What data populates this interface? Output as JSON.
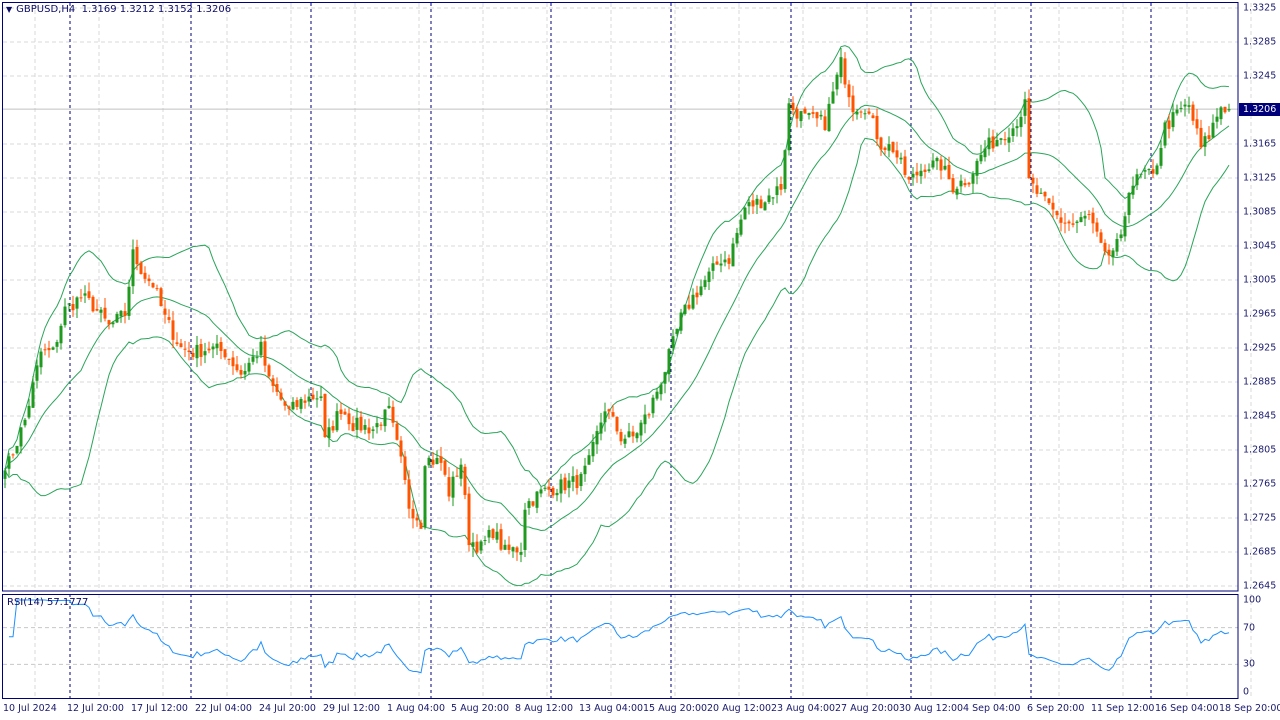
{
  "header": {
    "symbol": "GBPUSD,H4",
    "ohlc": "1.3169 1.3212 1.3152 1.3206",
    "current_price": "1.3206"
  },
  "rsi_label": "RSI(14) 57.1777",
  "price_axis": [
    "1.3325",
    "1.3285",
    "1.3245",
    "1.3165",
    "1.3125",
    "1.3085",
    "1.3045",
    "1.3005",
    "1.2965",
    "1.2925",
    "1.2885",
    "1.2845",
    "1.2805",
    "1.2765",
    "1.2725",
    "1.2685",
    "1.2645"
  ],
  "rsi_axis": [
    "100",
    "70",
    "30",
    "0"
  ],
  "time_axis": [
    "10 Jul 2024",
    "12 Jul 20:00",
    "17 Jul 12:00",
    "22 Jul 04:00",
    "24 Jul 20:00",
    "29 Jul 12:00",
    "1 Aug 04:00",
    "5 Aug 20:00",
    "8 Aug 12:00",
    "13 Aug 04:00",
    "15 Aug 20:00",
    "20 Aug 12:00",
    "23 Aug 04:00",
    "27 Aug 20:00",
    "30 Aug 12:00",
    "4 Sep 04:00",
    "6 Sep 20:00",
    "11 Sep 12:00",
    "16 Sep 04:00",
    "18 Sep 20:00"
  ],
  "colors": {
    "bull": "#1f9a1f",
    "bear": "#ff5500",
    "bands": "#2aa55a",
    "rsi": "#1e90ff",
    "axis": "#00007a",
    "grid": "#d8d8d8",
    "separator": "#00007a"
  },
  "chart_data": {
    "type": "candlestick",
    "symbol": "GBPUSD",
    "timeframe": "H4",
    "ylim": [
      1.2645,
      1.3325
    ],
    "bars_per_label": 16,
    "indicators": [
      "Bollinger Bands(20,2)",
      "RSI(14)"
    ],
    "close_keypoints": [
      [
        1,
        1.279
      ],
      [
        5,
        1.284
      ],
      [
        9,
        1.292
      ],
      [
        12,
        1.292
      ],
      [
        15,
        1.297
      ],
      [
        19,
        1.2985
      ],
      [
        22,
        1.2975
      ],
      [
        26,
        1.295
      ],
      [
        30,
        1.2965
      ],
      [
        32,
        1.3035
      ],
      [
        35,
        1.301
      ],
      [
        37,
        1.3
      ],
      [
        40,
        1.296
      ],
      [
        44,
        1.2925
      ],
      [
        47,
        1.292
      ],
      [
        51,
        1.2925
      ],
      [
        55,
        1.292
      ],
      [
        59,
        1.2895
      ],
      [
        64,
        1.2925
      ],
      [
        66,
        1.2885
      ],
      [
        71,
        1.285
      ],
      [
        75,
        1.2865
      ],
      [
        79,
        1.287
      ],
      [
        80,
        1.2815
      ],
      [
        84,
        1.2855
      ],
      [
        87,
        1.2835
      ],
      [
        92,
        1.283
      ],
      [
        96,
        1.285
      ],
      [
        99,
        1.279
      ],
      [
        101,
        1.274
      ],
      [
        104,
        1.272
      ],
      [
        105,
        1.2795
      ],
      [
        109,
        1.279
      ],
      [
        111,
        1.2755
      ],
      [
        114,
        1.279
      ],
      [
        116,
        1.27
      ],
      [
        119,
        1.269
      ],
      [
        122,
        1.271
      ],
      [
        125,
        1.2685
      ],
      [
        129,
        1.269
      ],
      [
        130,
        1.274
      ],
      [
        134,
        1.2755
      ],
      [
        137,
        1.276
      ],
      [
        144,
        1.277
      ],
      [
        146,
        1.279
      ],
      [
        150,
        1.2855
      ],
      [
        154,
        1.282
      ],
      [
        157,
        1.282
      ],
      [
        161,
        1.285
      ],
      [
        165,
        1.29
      ],
      [
        169,
        1.296
      ],
      [
        172,
        1.2985
      ],
      [
        176,
        1.301
      ],
      [
        179,
        1.303
      ],
      [
        181,
        1.303
      ],
      [
        185,
        1.309
      ],
      [
        190,
        1.31
      ],
      [
        194,
        1.3115
      ],
      [
        196,
        1.321
      ],
      [
        200,
        1.3195
      ],
      [
        205,
        1.319
      ],
      [
        209,
        1.326
      ],
      [
        212,
        1.321
      ],
      [
        215,
        1.321
      ],
      [
        219,
        1.3165
      ],
      [
        222,
        1.316
      ],
      [
        226,
        1.312
      ],
      [
        230,
        1.314
      ],
      [
        234,
        1.314
      ],
      [
        237,
        1.3115
      ],
      [
        241,
        1.3125
      ],
      [
        245,
        1.316
      ],
      [
        249,
        1.3175
      ],
      [
        252,
        1.3185
      ],
      [
        255,
        1.321
      ],
      [
        256,
        1.312
      ],
      [
        260,
        1.3095
      ],
      [
        264,
        1.3075
      ],
      [
        267,
        1.307
      ],
      [
        271,
        1.308
      ],
      [
        275,
        1.303
      ],
      [
        279,
        1.305
      ],
      [
        281,
        1.3115
      ],
      [
        285,
        1.313
      ],
      [
        287,
        1.3125
      ],
      [
        290,
        1.3185
      ],
      [
        294,
        1.3205
      ],
      [
        296,
        1.321
      ],
      [
        299,
        1.316
      ],
      [
        301,
        1.3175
      ],
      [
        304,
        1.321
      ],
      [
        306,
        1.3206
      ]
    ]
  }
}
